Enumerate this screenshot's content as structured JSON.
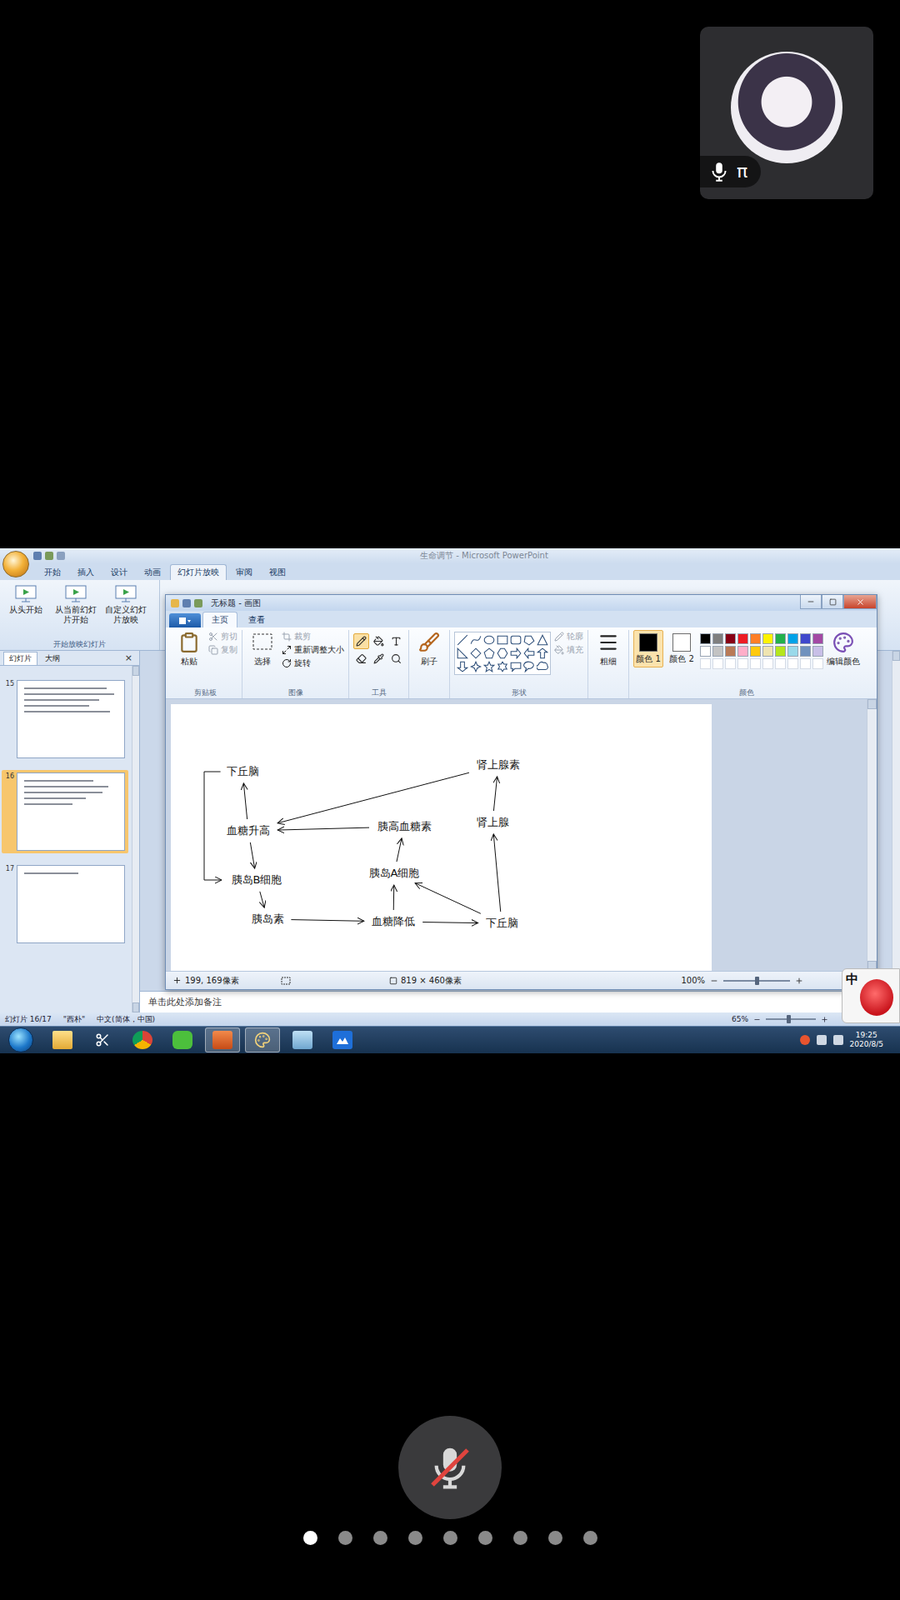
{
  "participant": {
    "name": "π",
    "mic_on": true
  },
  "screen_share": {
    "powerpoint": {
      "title": "生命调节 - Microsoft PowerPoint",
      "tabs": [
        {
          "label": "开始",
          "selected": false
        },
        {
          "label": "插入",
          "selected": false
        },
        {
          "label": "设计",
          "selected": false
        },
        {
          "label": "动画",
          "selected": false
        },
        {
          "label": "幻灯片放映",
          "selected": true
        },
        {
          "label": "审阅",
          "selected": false
        },
        {
          "label": "视图",
          "selected": false
        }
      ],
      "ribbon_buttons": [
        "从头开始",
        "从当前幻灯片开始",
        "自定义幻灯片放映"
      ],
      "ribbon_group": "开始放映幻灯片",
      "panel_tabs": [
        {
          "label": "幻灯片",
          "selected": true
        },
        {
          "label": "大纲",
          "selected": false
        }
      ],
      "panel_close": "×",
      "slides": [
        {
          "number": "15",
          "selected": false
        },
        {
          "number": "16",
          "selected": true
        },
        {
          "number": "17",
          "selected": false
        }
      ],
      "notes_placeholder": "单击此处添加备注",
      "status": {
        "slide": "幻灯片 16/17",
        "theme": "\"西朴\"",
        "language": "中文(简体，中国)",
        "zoom": "65%",
        "zoom_level": 0.45
      }
    },
    "paint": {
      "title": "无标题 - 画图",
      "tabs": [
        {
          "label": "主页",
          "selected": true
        },
        {
          "label": "查看",
          "selected": false
        }
      ],
      "clipboard": {
        "label": "剪贴板",
        "main": "粘贴",
        "items": [
          {
            "label": "剪切",
            "disabled": true
          },
          {
            "label": "复制",
            "disabled": true
          }
        ]
      },
      "image": {
        "label": "图像",
        "main": "选择",
        "items": [
          {
            "label": "裁剪",
            "disabled": true
          },
          {
            "label": "重新调整大小",
            "disabled": false
          },
          {
            "label": "旋转",
            "disabled": false
          }
        ]
      },
      "tools": {
        "label": "工具",
        "items": [
          {
            "kind": "pencil",
            "selected": true
          },
          {
            "kind": "fill",
            "selected": false
          },
          {
            "kind": "text",
            "selected": false
          },
          {
            "kind": "eraser",
            "selected": false
          },
          {
            "kind": "picker",
            "selected": false
          },
          {
            "kind": "magnifier",
            "selected": false
          }
        ]
      },
      "brushes": "刷子",
      "shapes": {
        "label": "形状",
        "items": [
          {
            "label": "轮廓",
            "disabled": true
          },
          {
            "label": "填充",
            "disabled": true
          }
        ]
      },
      "size": "粗细",
      "color_slots": [
        {
          "label": "颜色 1",
          "color": "#000000",
          "selected": true
        },
        {
          "label": "颜色 2",
          "color": "#ffffff",
          "selected": false
        }
      ],
      "palette": [
        "#000000",
        "#7f7f7f",
        "#880015",
        "#ed1c24",
        "#ff7f27",
        "#fff200",
        "#22b14c",
        "#00a2e8",
        "#3f48cc",
        "#a349a4",
        "#ffffff",
        "#c3c3c3",
        "#b97a57",
        "#ffaec9",
        "#ffc90e",
        "#efe4b0",
        "#b5e61d",
        "#99d9ea",
        "#7092be",
        "#c8bfe7"
      ],
      "edit_colors": "编辑颜色",
      "colors_label": "颜色",
      "canvas": {
        "nodes": [
          {
            "label": "下丘脑"
          },
          {
            "label": "肾上腺素"
          },
          {
            "label": "血糖升高"
          },
          {
            "label": "胰高血糖素"
          },
          {
            "label": "肾上腺"
          },
          {
            "label": "胰岛B细胞"
          },
          {
            "label": "胰岛A细胞"
          },
          {
            "label": "胰岛素"
          },
          {
            "label": "血糖降低"
          },
          {
            "label": "下丘脑"
          }
        ],
        "edges": [
          {
            "from": 2,
            "to": 0,
            "kind": "straight"
          },
          {
            "from": 0,
            "to": 5,
            "kind": "bracket"
          },
          {
            "from": 2,
            "to": 5,
            "kind": "straight"
          },
          {
            "from": 5,
            "to": 7,
            "kind": "straight"
          },
          {
            "from": 7,
            "to": 8,
            "kind": "straight"
          },
          {
            "from": 8,
            "to": 9,
            "kind": "straight"
          },
          {
            "from": 9,
            "to": 6,
            "kind": "straight"
          },
          {
            "from": 9,
            "to": 4,
            "kind": "straight"
          },
          {
            "from": 4,
            "to": 1,
            "kind": "straight"
          },
          {
            "from": 1,
            "to": 2,
            "kind": "straight"
          },
          {
            "from": 8,
            "to": 6,
            "kind": "straight"
          },
          {
            "from": 6,
            "to": 3,
            "kind": "straight"
          },
          {
            "from": 3,
            "to": 2,
            "kind": "straight"
          }
        ]
      },
      "status": {
        "cursor": "199, 169像素",
        "canvas_size": "819 × 460像素",
        "zoom": "100%",
        "zoom_level": 0.5
      }
    },
    "taskbar": {
      "apps": [
        {
          "kind": "explorer",
          "active": false
        },
        {
          "kind": "snipping",
          "active": false
        },
        {
          "kind": "chrome",
          "active": false
        },
        {
          "kind": "wechat",
          "active": false
        },
        {
          "kind": "powerpoint",
          "active": true
        },
        {
          "kind": "paint",
          "active": true
        },
        {
          "kind": "window",
          "active": false
        },
        {
          "kind": "app",
          "active": false
        }
      ],
      "time": "19:25",
      "date": "2020/8/5",
      "ime": "中"
    }
  },
  "mute_button": {
    "muted": true
  },
  "page_dots": [
    {
      "selected": true
    },
    {
      "selected": false
    },
    {
      "selected": false
    },
    {
      "selected": false
    },
    {
      "selected": false
    },
    {
      "selected": false
    },
    {
      "selected": false
    },
    {
      "selected": false
    },
    {
      "selected": false
    }
  ]
}
